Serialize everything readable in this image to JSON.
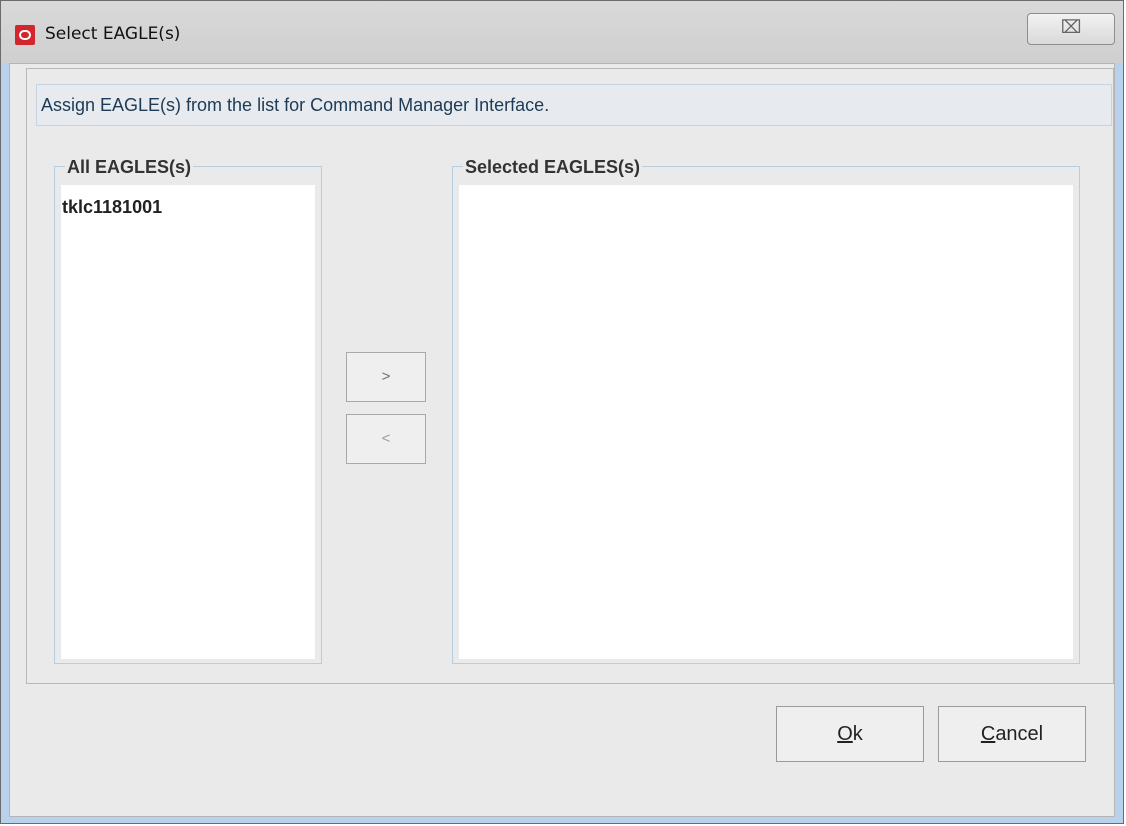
{
  "window": {
    "title": "Select EAGLE(s)",
    "close_glyph": "⌧"
  },
  "instruction": "Assign EAGLE(s) from the list for Command Manager Interface.",
  "all_list": {
    "title": "All EAGLES(s)",
    "items": [
      "tklc1181001"
    ]
  },
  "selected_list": {
    "title": "Selected EAGLES(s)",
    "items": []
  },
  "buttons": {
    "add": ">",
    "remove": "<",
    "ok_mnemonic": "O",
    "ok_rest": "k",
    "cancel_mnemonic": "C",
    "cancel_rest": "ancel"
  },
  "icons": {
    "app": "oracle-app-icon",
    "close": "close-icon"
  },
  "colors": {
    "accent": "#d3252b",
    "instruction_text": "#1e3a55"
  }
}
